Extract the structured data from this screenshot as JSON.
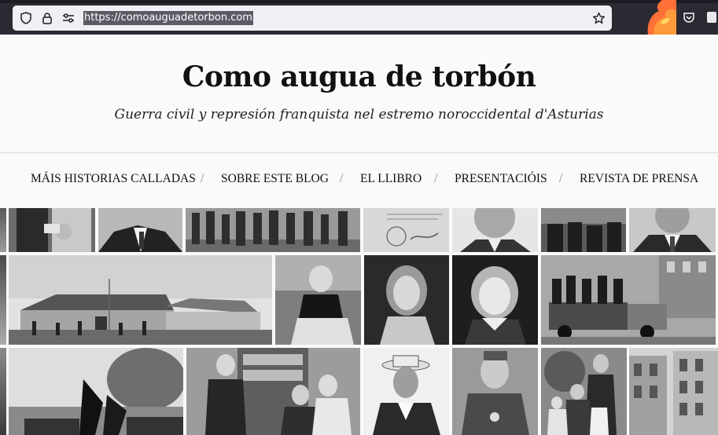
{
  "browser": {
    "url": "https://comoauguadetorbon.com",
    "icons": [
      "shield-icon",
      "lock-icon",
      "permissions-icon",
      "bookmark-star-icon",
      "pocket-icon",
      "firefox-logo-icon"
    ]
  },
  "site": {
    "title": "Como augua de torbón",
    "tagline": "Guerra civil y represión franquista nel estremo noroccidental d'Asturias"
  },
  "nav": {
    "items": [
      {
        "label": "MÁIS HISTORIAS CALLADAS"
      },
      {
        "label": "SOBRE ESTE BLOG"
      },
      {
        "label": "EL LLIBRO"
      },
      {
        "label": "PRESENTACIÓIS"
      },
      {
        "label": "REVISTA DE PRENSA"
      }
    ],
    "separator": "/"
  },
  "mosaic": {
    "photos": [
      "couple-photo",
      "man-portrait",
      "marching-soldiers",
      "document-with-stamp",
      "young-man-portrait",
      "seated-group",
      "man-in-suit",
      "village-farmhouse",
      "woman-seated-rocks",
      "woman-portrait",
      "girl-portrait",
      "soldiers-on-truck",
      "crowd-with-flags",
      "men-in-office",
      "man-with-hat",
      "soldier-portrait",
      "family-group",
      "town-street"
    ]
  }
}
